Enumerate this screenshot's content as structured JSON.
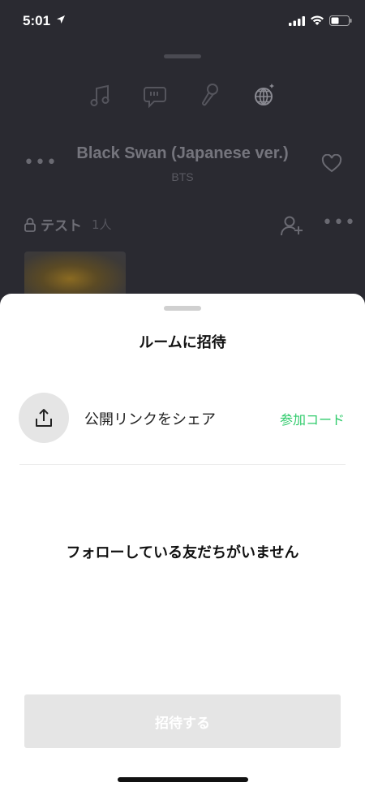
{
  "status_bar": {
    "time": "5:01"
  },
  "background": {
    "top_icons": [
      "music-note-icon",
      "lyrics-bubble-icon",
      "microphone-icon",
      "disco-ball-icon"
    ],
    "song": {
      "title": "Black Swan (Japanese ver.)",
      "artist": "BTS",
      "more": "•••"
    },
    "room": {
      "name": "テスト",
      "count": "1人",
      "more": "•••"
    }
  },
  "sheet": {
    "title": "ルームに招待",
    "share_label": "公開リンクをシェア",
    "join_code_label": "参加コード",
    "empty_message": "フォローしている友だちがいません",
    "invite_button": "招待する"
  },
  "colors": {
    "accent_green": "#2fcb6b",
    "sheet_bg": "#ffffff",
    "dim_bg": "#2a2a31",
    "disabled_button": "#e5e5e5"
  }
}
